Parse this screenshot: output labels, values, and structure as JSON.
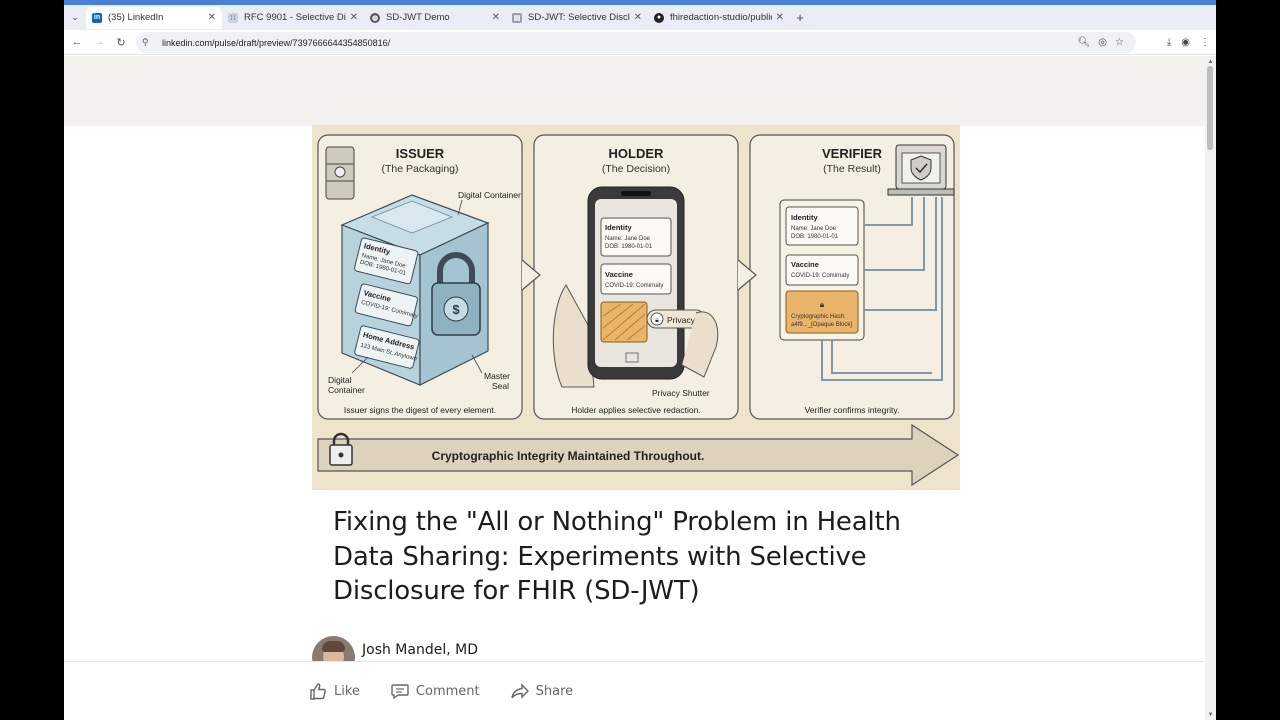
{
  "browser": {
    "tabs": [
      {
        "title": "(35) LinkedIn",
        "favicon": "linkedin-icon",
        "active": true
      },
      {
        "title": "RFC 9901 - Selective Disclosure",
        "favicon": "rfc-icon",
        "active": false
      },
      {
        "title": "SD-JWT Demo",
        "favicon": "globe-icon",
        "active": false
      },
      {
        "title": "SD-JWT: Selective Disclosure",
        "favicon": "doc-icon",
        "active": false
      },
      {
        "title": "fhiredaction-studio/public",
        "favicon": "github-icon",
        "active": false
      }
    ],
    "new_tab": "+",
    "url": "linkedin.com/pulse/draft/preview/7397666644354850816/"
  },
  "hero": {
    "issuer": {
      "title": "ISSUER",
      "subtitle": "(The Packaging)",
      "label_container_top": "Digital Container",
      "label_container_bottom": [
        "Digital",
        "Container"
      ],
      "label_seal": [
        "Master",
        "Seal"
      ],
      "caption": "Issuer signs the digest of every element.",
      "cards": [
        {
          "heading": "Identity",
          "lines": [
            "Name: Jane Doe",
            "DOB: 1980-01-01"
          ]
        },
        {
          "heading": "Vaccine",
          "lines": [
            "COVID-19: Comirnaty"
          ]
        },
        {
          "heading": "Home Address",
          "lines": [
            "123 Main St, Anytown"
          ]
        }
      ]
    },
    "holder": {
      "title": "HOLDER",
      "subtitle": "(The Decision)",
      "cards": [
        {
          "heading": "Identity",
          "lines": [
            "Name: Jane Doe",
            "DOB: 1980-01-01"
          ]
        },
        {
          "heading": "Vaccine",
          "lines": [
            "COVID-19: Comirnaty"
          ]
        }
      ],
      "privacy_button": "Privacy",
      "label_shutter": "Privacy Shutter",
      "caption": "Holder applies selective redaction."
    },
    "verifier": {
      "title": "VERIFIER",
      "subtitle": "(The Result)",
      "cards": [
        {
          "heading": "Identity",
          "lines": [
            "Name: Jane Doe",
            "DOB: 1980-01-01"
          ]
        },
        {
          "heading": "Vaccine",
          "lines": [
            "COVID-19: Comirnaty"
          ]
        }
      ],
      "hash_heading": "Cryptographic Hash:",
      "hash_value": "a4f9..._[Opaque Block]",
      "caption": "Verifier confirms integrity."
    },
    "banner": "Cryptographic Integrity Maintained Throughout."
  },
  "article": {
    "title": "Fixing the \"All or Nothing\" Problem in Health Data Sharing: Experiments with Selective Disclosure for FHIR (SD-JWT)",
    "author": "Josh Mandel, MD"
  },
  "actions": {
    "like": "Like",
    "comment": "Comment",
    "share": "Share"
  }
}
